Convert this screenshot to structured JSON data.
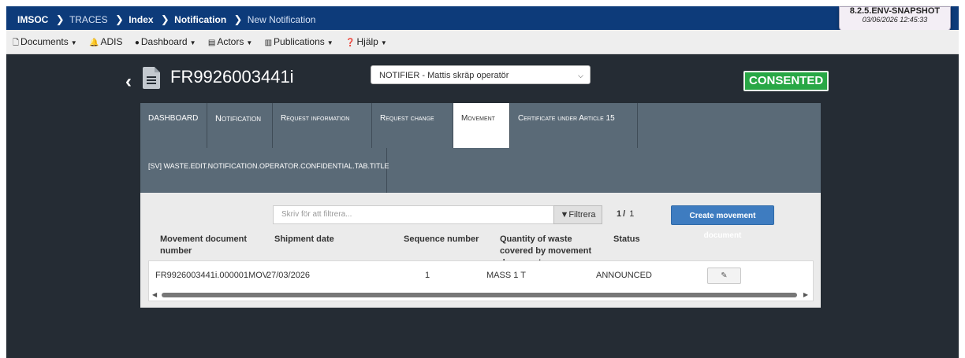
{
  "breadcrumb": {
    "items": [
      "IMSOC",
      "TRACES",
      "Index",
      "Notification",
      "New Notification"
    ]
  },
  "version": {
    "label": "8.2.5.ENV-SNAPSHOT",
    "timestamp": "03/06/2026 12:45:33"
  },
  "menu": {
    "items": [
      {
        "label": "Documents",
        "icon": "file-icon"
      },
      {
        "label": "ADIS",
        "icon": "bell-icon"
      },
      {
        "label": "Dashboard",
        "icon": "globe-icon"
      },
      {
        "label": "Actors",
        "icon": "id-card-icon"
      },
      {
        "label": "Publications",
        "icon": "book-icon"
      },
      {
        "label": "Hjälp",
        "icon": "question-icon"
      }
    ]
  },
  "header": {
    "doc_number": "FR9926003441i",
    "notifier": "NOTIFIER - Mattis skräp operatör",
    "status": "CONSENTED"
  },
  "tabs": [
    "DASHBOARD",
    "Notification",
    "Request information",
    "Request change",
    "Movement",
    "Certificate under Article 15",
    "[SV] WASTE.EDIT.NOTIFICATION.OPERATOR.CONFIDENTIAL.TAB.TITLE"
  ],
  "active_tab": "Movement",
  "movement": {
    "filter_placeholder": "Skriv för att filtrera...",
    "filter_button": "Filtrera",
    "page_current": "1",
    "page_sep": "/",
    "page_total": "1",
    "create_button": "Create movement document",
    "columns": [
      "Movement document number",
      "Shipment date",
      "Sequence number",
      "Quantity of waste covered by movement document",
      "Status"
    ],
    "rows": [
      {
        "number": "FR9926003441i.000001MOV",
        "date": "27/03/2026",
        "sequence": "1",
        "quantity": "MASS 1 T",
        "status": "ANNOUNCED"
      }
    ]
  },
  "colors": {
    "topbar": "#0d3b7a",
    "main_bg": "#252c34",
    "tabs_bg": "#5a6a77",
    "status_green": "#28a745",
    "primary_button": "#3e7cc0"
  }
}
